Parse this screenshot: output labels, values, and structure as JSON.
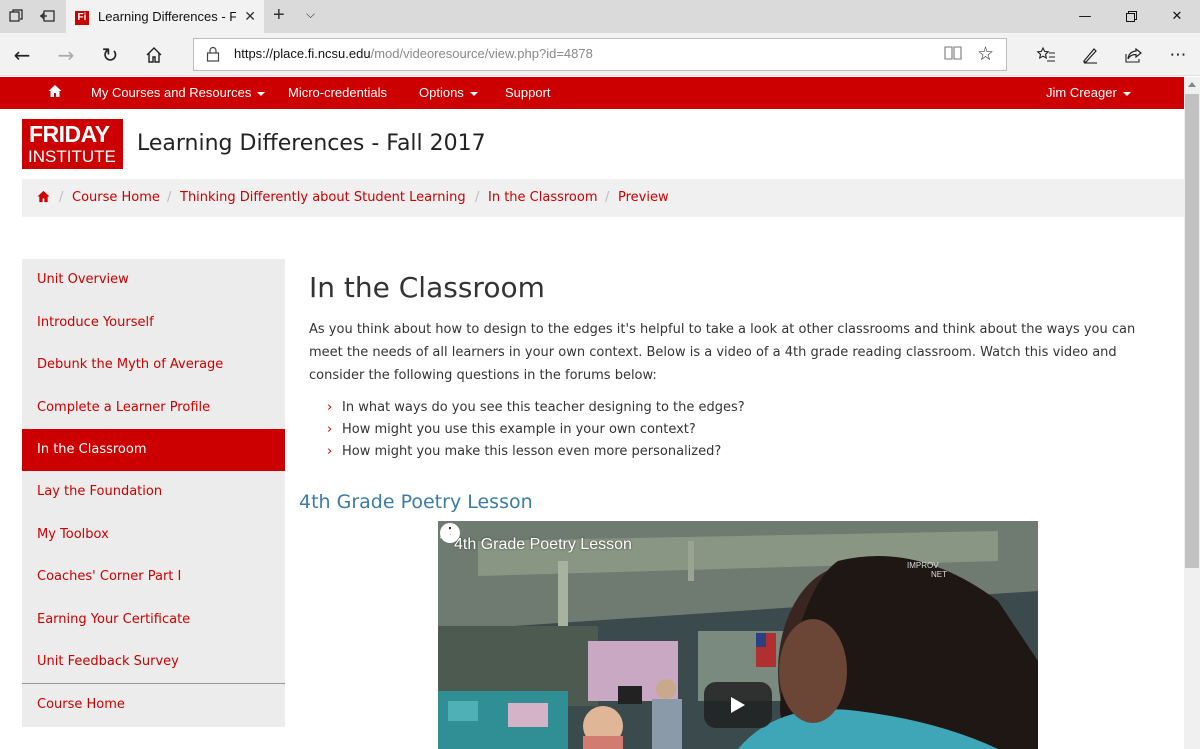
{
  "browser": {
    "tab_title": "Learning Differences - F",
    "favicon_text": "Fi",
    "url_host": "https://place.fi.ncsu.edu",
    "url_path": "/mod/videoresource/view.php?id=4878"
  },
  "topnav": {
    "items": [
      "My Courses and Resources",
      "Micro-credentials",
      "Options",
      "Support"
    ],
    "user": "Jim Creager"
  },
  "header": {
    "logo_line1": "FRIDAY",
    "logo_line2": "INSTITUTE",
    "site_title": "Learning Differences - Fall 2017"
  },
  "breadcrumb": [
    "Course Home",
    "Thinking Differently about Student Learning",
    "In the Classroom",
    "Preview"
  ],
  "sidebar": {
    "items": [
      {
        "label": "Unit Overview"
      },
      {
        "label": "Introduce Yourself"
      },
      {
        "label": "Debunk the Myth of Average"
      },
      {
        "label": "Complete a Learner Profile"
      },
      {
        "label": "In the Classroom",
        "active": true
      },
      {
        "label": "Lay the Foundation"
      },
      {
        "label": "My Toolbox"
      },
      {
        "label": "Coaches' Corner Part I"
      },
      {
        "label": "Earning Your Certificate"
      },
      {
        "label": "Unit Feedback Survey"
      }
    ],
    "footer_item": "Course Home"
  },
  "main": {
    "heading": "In the Classroom",
    "intro": "As you think about how to design to the edges it's helpful to take a look at other classrooms and think about the ways you can meet the needs of all learners in your own context. Below is a video of a 4th grade reading classroom. Watch this video and consider the following questions in the forums below:",
    "questions": [
      "In what ways do you see this teacher designing to the edges?",
      "How might you use this example in your own context?",
      "How might you make this lesson even more personalized?"
    ],
    "video_heading": "4th Grade Poetry Lesson",
    "video": {
      "title": "4th Grade Poetry Lesson",
      "watermark_line1": "IMPROV",
      "watermark_line2": "NET"
    }
  },
  "colors": {
    "brand_red": "#cc0000",
    "link_blue": "#3a7ca5"
  }
}
